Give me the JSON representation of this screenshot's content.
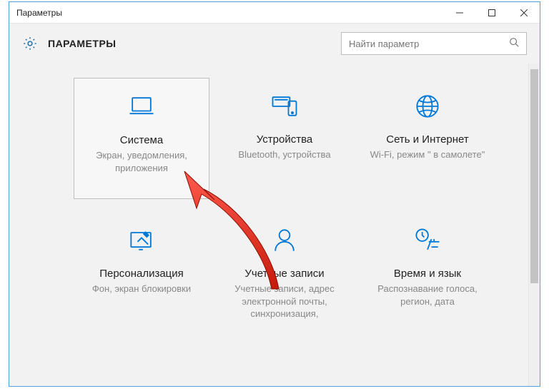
{
  "window": {
    "title": "Параметры"
  },
  "header": {
    "title": "ПАРАМЕТРЫ"
  },
  "search": {
    "placeholder": "Найти параметр"
  },
  "tiles": [
    {
      "title": "Система",
      "desc": "Экран, уведомления, приложения"
    },
    {
      "title": "Устройства",
      "desc": "Bluetooth, устройства"
    },
    {
      "title": "Сеть и Интернет",
      "desc": "Wi-Fi, режим \" в самолете\""
    },
    {
      "title": "Персонализация",
      "desc": "Фон, экран блокировки"
    },
    {
      "title": "Учетные записи",
      "desc": "Учетные записи, адрес электронной почты, синхронизация,"
    },
    {
      "title": "Время и язык",
      "desc": "Распознавание голоса, регион, дата"
    }
  ]
}
